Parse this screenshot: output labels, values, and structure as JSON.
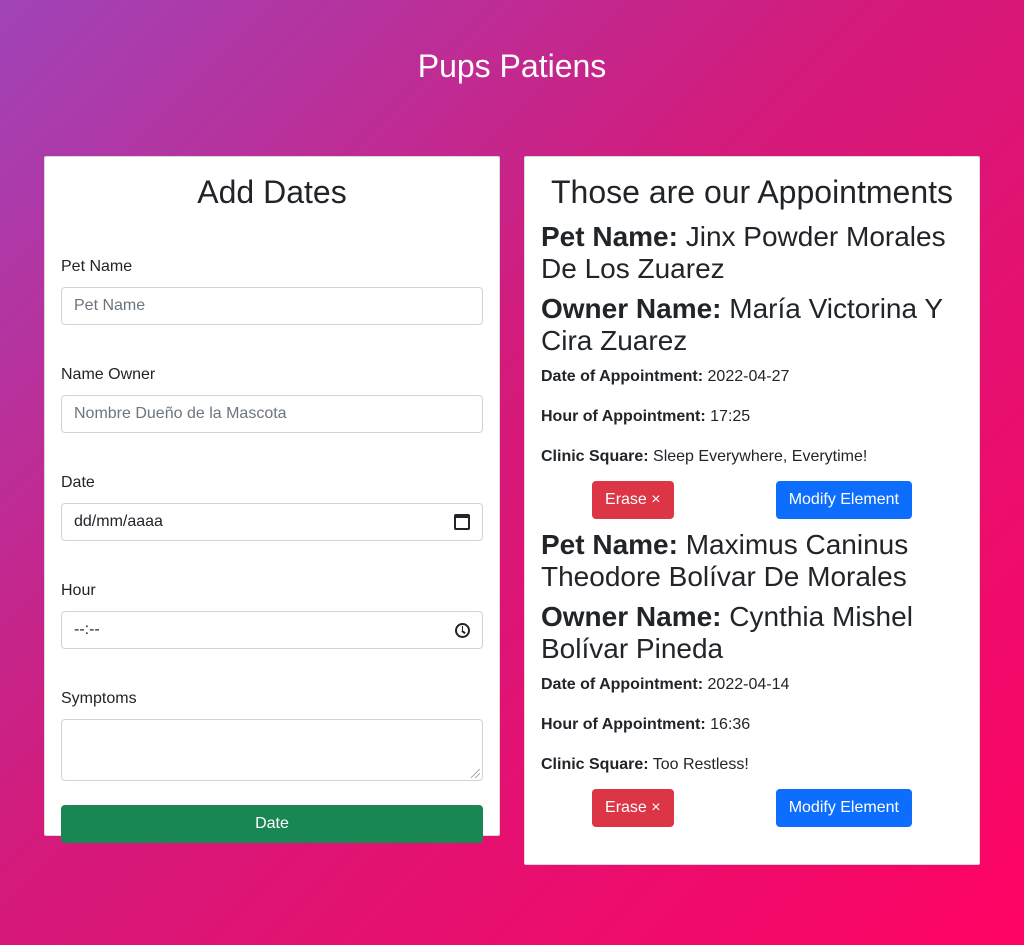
{
  "app": {
    "title": "Pups Patiens"
  },
  "form": {
    "title": "Add Dates",
    "pet_name_label": "Pet Name",
    "pet_name_placeholder": "Pet Name",
    "owner_label": "Name Owner",
    "owner_placeholder": "Nombre Dueño de la Mascota",
    "date_label": "Date",
    "date_value": "dd/mm/aaaa",
    "hour_label": "Hour",
    "hour_value": "--:--",
    "symptoms_label": "Symptoms",
    "submit_label": "Date"
  },
  "list": {
    "title": "Those are our Appointments",
    "labels": {
      "pet": "Pet Name:",
      "owner": "Owner Name:",
      "date": "Date of Appointment:",
      "hour": "Hour of Appointment:",
      "clinic": "Clinic Square:"
    },
    "erase_label": "Erase ×",
    "modify_label": "Modify Element",
    "appointments": [
      {
        "pet": "Jinx Powder Morales De Los Zuarez",
        "owner": "María Victorina Y Cira Zuarez",
        "date": "2022-04-27",
        "hour": "17:25",
        "clinic": "Sleep Everywhere, Everytime!"
      },
      {
        "pet": "Maximus Caninus Theodore Bolívar De Morales",
        "owner": "Cynthia Mishel Bolívar Pineda",
        "date": "2022-04-14",
        "hour": "16:36",
        "clinic": "Too Restless!"
      }
    ]
  },
  "colors": {
    "success": "#198754",
    "danger": "#dc3545",
    "primary": "#0d6efd"
  }
}
